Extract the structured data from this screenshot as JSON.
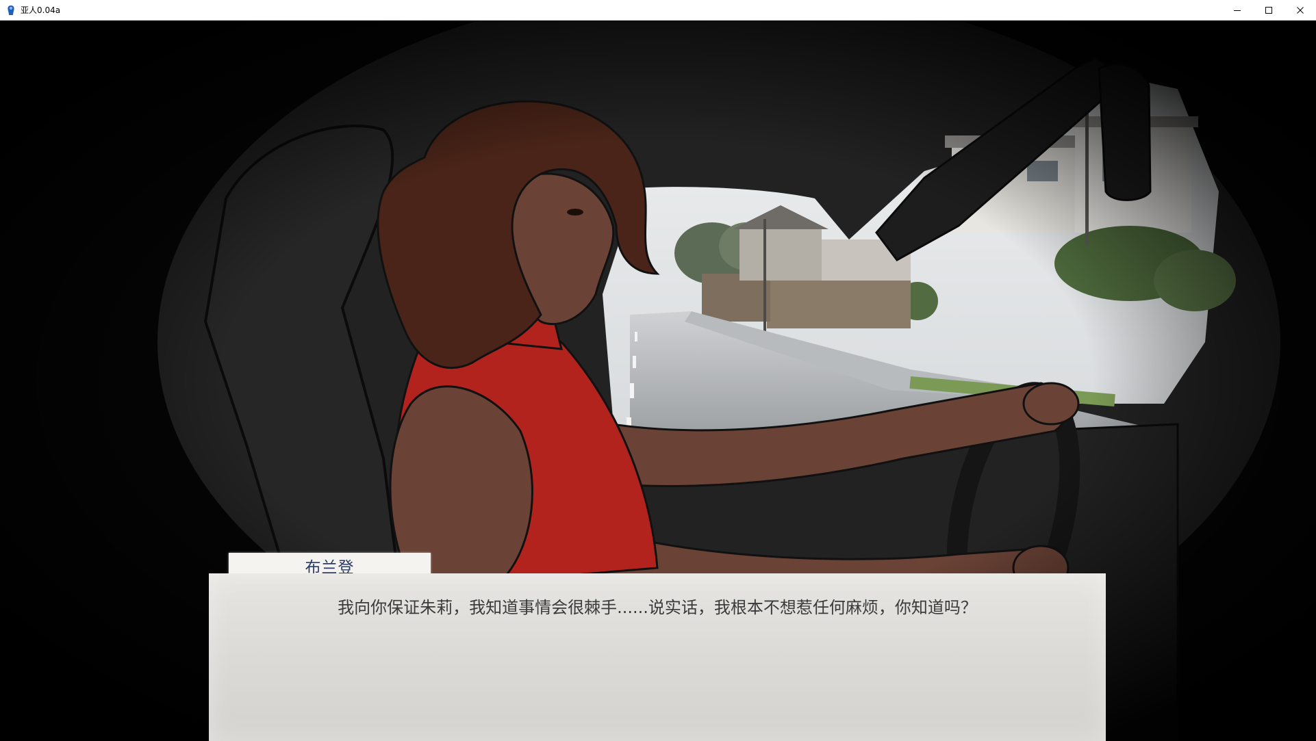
{
  "window": {
    "title": "亚人0.04a",
    "icons": {
      "app": "app-icon",
      "minimize": "minimize-icon",
      "maximize": "maximize-icon",
      "close": "close-icon"
    }
  },
  "dialogue": {
    "speaker": "布兰登",
    "text": "我向你保证朱莉，我知道事情会很棘手......说实话，我根本不想惹任何麻烦，你知道吗？"
  },
  "colors": {
    "background": "#000000",
    "car_interior": "#1e1e1e",
    "dress": "#b3231d",
    "skin": "#6a4236",
    "hair": "#4a2418",
    "dialogue_paper": "#e2e1dd",
    "speaker_text": "#2c3a66"
  }
}
